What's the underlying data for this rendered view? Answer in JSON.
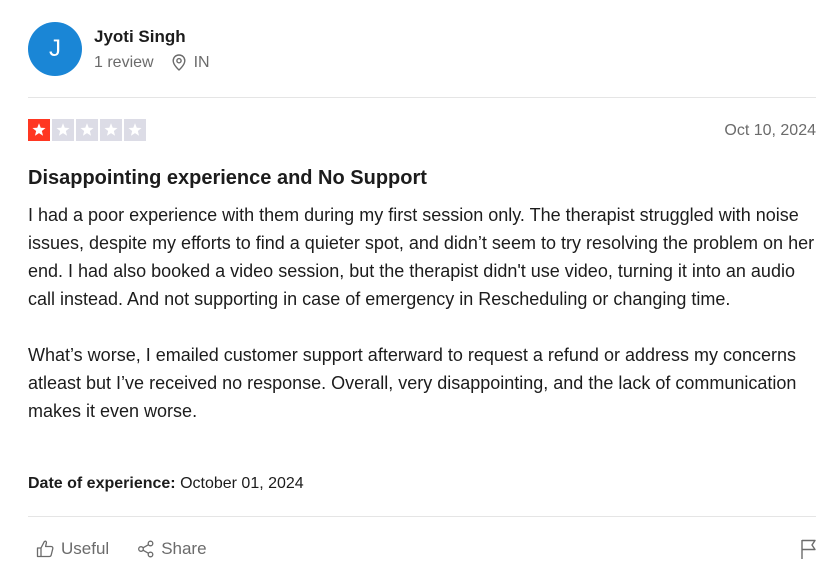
{
  "reviewer": {
    "avatar_initial": "J",
    "name": "Jyoti Singh",
    "review_count": "1 review",
    "country": "IN",
    "avatar_color": "#1a86d6"
  },
  "review": {
    "rating": 1,
    "max_rating": 5,
    "star_filled_color": "#ff3722",
    "star_empty_color": "#dcdce6",
    "date": "Oct 10, 2024",
    "title": "Disappointing experience and No Support",
    "paragraphs": [
      "I had a poor experience with them during my first session only. The therapist struggled with noise issues, despite my efforts to find a quieter spot, and didn’t seem to try resolving the problem on her end. I had also booked a video session, but the therapist didn't use video, turning it into an audio call instead. And not supporting in case of emergency in Rescheduling or changing time.",
      "What’s worse, I emailed customer support afterward to request a refund or address my concerns atleast but I’ve received no response. Overall, very disappointing, and the lack of communication makes it even worse."
    ],
    "experience_label": "Date of experience:",
    "experience_date": "October 01, 2024"
  },
  "actions": {
    "useful_label": "Useful",
    "share_label": "Share"
  },
  "icons": {
    "location": "location-pin-icon",
    "useful": "thumbs-up-icon",
    "share": "share-icon",
    "report": "flag-icon"
  }
}
